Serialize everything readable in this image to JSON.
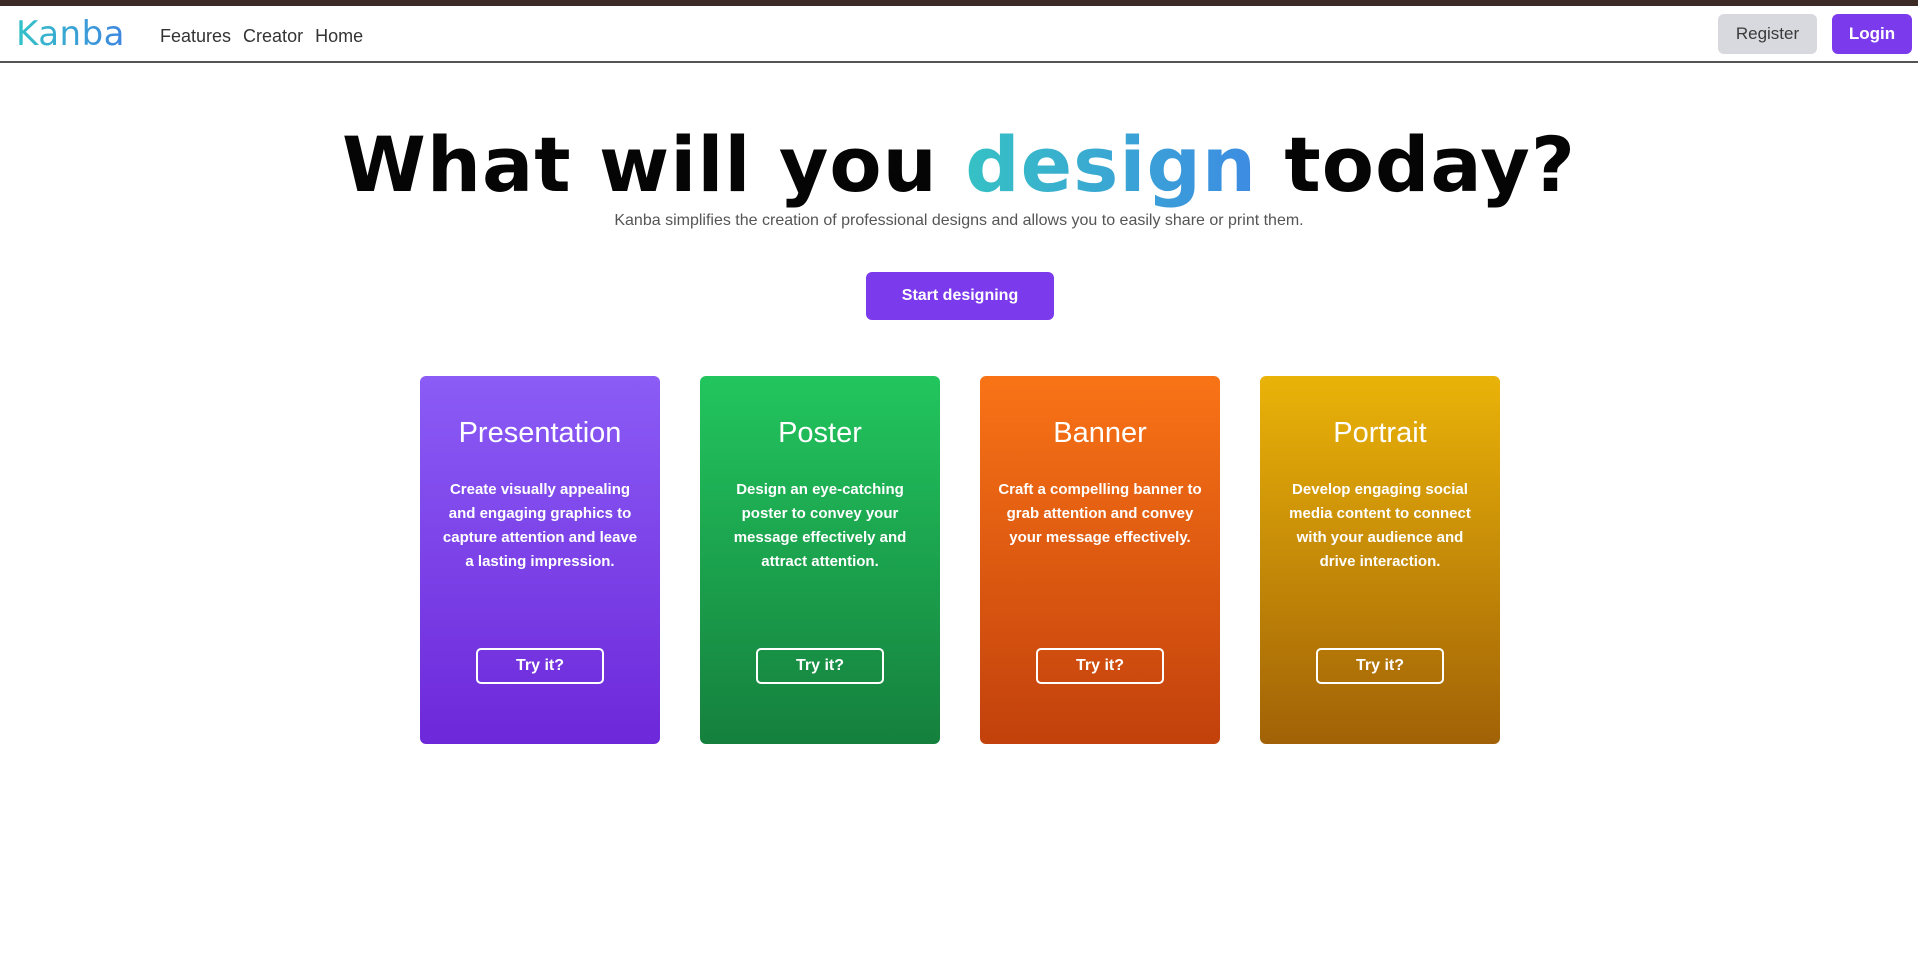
{
  "navbar": {
    "brand": "Kanba",
    "links": [
      "Features",
      "Creator",
      "Home"
    ],
    "register_label": "Register",
    "login_label": "Login"
  },
  "hero": {
    "title_before": "What will you ",
    "title_accent": "design",
    "title_after": " today?",
    "subtitle": "Kanba simplifies the creation of professional designs and allows you to easily share or print them.",
    "cta_label": "Start designing"
  },
  "cards": [
    {
      "title": "Presentation",
      "description": "Create visually appealing and engaging graphics to capture attention and leave a lasting impression.",
      "button": "Try it?",
      "color": "#7c3aed"
    },
    {
      "title": "Poster",
      "description": "Design an eye-catching poster to convey your message effectively and attract attention.",
      "button": "Try it?",
      "color": "#16a34a"
    },
    {
      "title": "Banner",
      "description": "Craft a compelling banner to grab attention and convey your message effectively.",
      "button": "Try it?",
      "color": "#ea580c"
    },
    {
      "title": "Portrait",
      "description": "Develop engaging social media content to connect with your audience and drive interaction.",
      "button": "Try it?",
      "color": "#ca8a04"
    }
  ],
  "colors": {
    "brand_accent": "#7c3aed",
    "logo_gradient_start": "#33c3c8",
    "logo_gradient_end": "#3f86e0"
  }
}
